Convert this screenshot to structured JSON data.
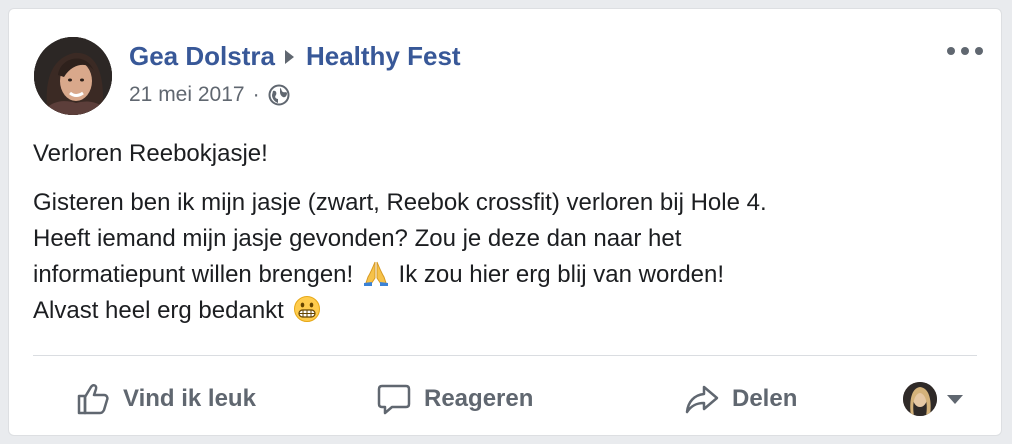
{
  "post": {
    "author": "Gea Dolstra",
    "group": "Healthy Fest",
    "date": "21 mei 2017",
    "separator": "·",
    "title": "Verloren Reebokjasje!",
    "body_lines": [
      "Gisteren ben ik mijn jasje (zwart, Reebok crossfit) verloren bij Hole 4.",
      "Heeft iemand mijn jasje gevonden? Zou je deze dan naar het",
      "informatiepunt willen brengen!",
      "Ik zou hier erg blij van worden!",
      "Alvast heel erg bedankt"
    ]
  },
  "actions": {
    "like_label": "Vind ik leuk",
    "comment_label": "Reageren",
    "share_label": "Delen"
  },
  "icons": {
    "audience": "globe-icon",
    "more": "more-options-icon",
    "like": "thumbs-up-icon",
    "comment": "comment-bubble-icon",
    "share": "share-arrow-icon",
    "emoji_1": "folded-hands-emoji",
    "emoji_2": "grimacing-face-emoji"
  },
  "colors": {
    "link": "#385898",
    "secondary_text": "#606770",
    "text": "#1c1e21",
    "card_border": "#dddfe2",
    "background": "#e9ebee"
  }
}
